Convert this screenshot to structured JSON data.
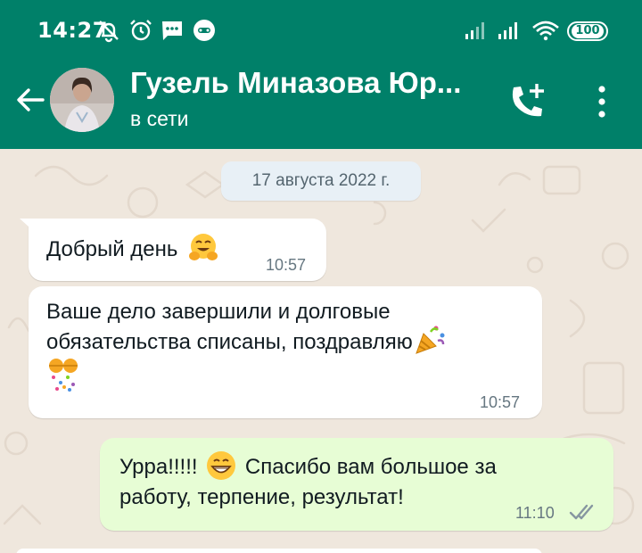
{
  "status_bar": {
    "time": "14:27",
    "battery": "100",
    "icons": [
      "muted-bell-icon",
      "alarm-icon",
      "sms-icon",
      "game-controller-icon",
      "signal-icon",
      "signal-icon",
      "wifi-icon",
      "battery-icon"
    ]
  },
  "header": {
    "contact_name": "Гузель Миназова Юр...",
    "presence": "в сети",
    "icons": [
      "back-arrow-icon",
      "add-call-icon",
      "more-vert-icon"
    ]
  },
  "chat": {
    "date_chip": "17 августа 2022 г.",
    "messages": [
      {
        "direction": "incoming",
        "text": "Добрый день",
        "emoji": "hugging-face",
        "time": "10:57"
      },
      {
        "direction": "incoming",
        "line1": "Ваше дело завершили и долговые",
        "line2": "обязательства списаны, поздравляю",
        "emoji": [
          "party-popper",
          "confetti-ball"
        ],
        "time": "10:57"
      },
      {
        "direction": "outgoing",
        "part1": "Урра!!!!!",
        "emoji": "grinning-face",
        "part2": "Спасибо вам большое за",
        "line2": "работу, терпение, результат!",
        "time": "11:10",
        "read_status": "double-check-icon"
      }
    ]
  },
  "colors": {
    "header_bg": "#008069",
    "chat_bg": "#efe7dd",
    "incoming_bubble": "#ffffff",
    "outgoing_bubble": "#e7fdd5",
    "date_chip_bg": "#e8f0f6",
    "timestamp": "#667781"
  }
}
